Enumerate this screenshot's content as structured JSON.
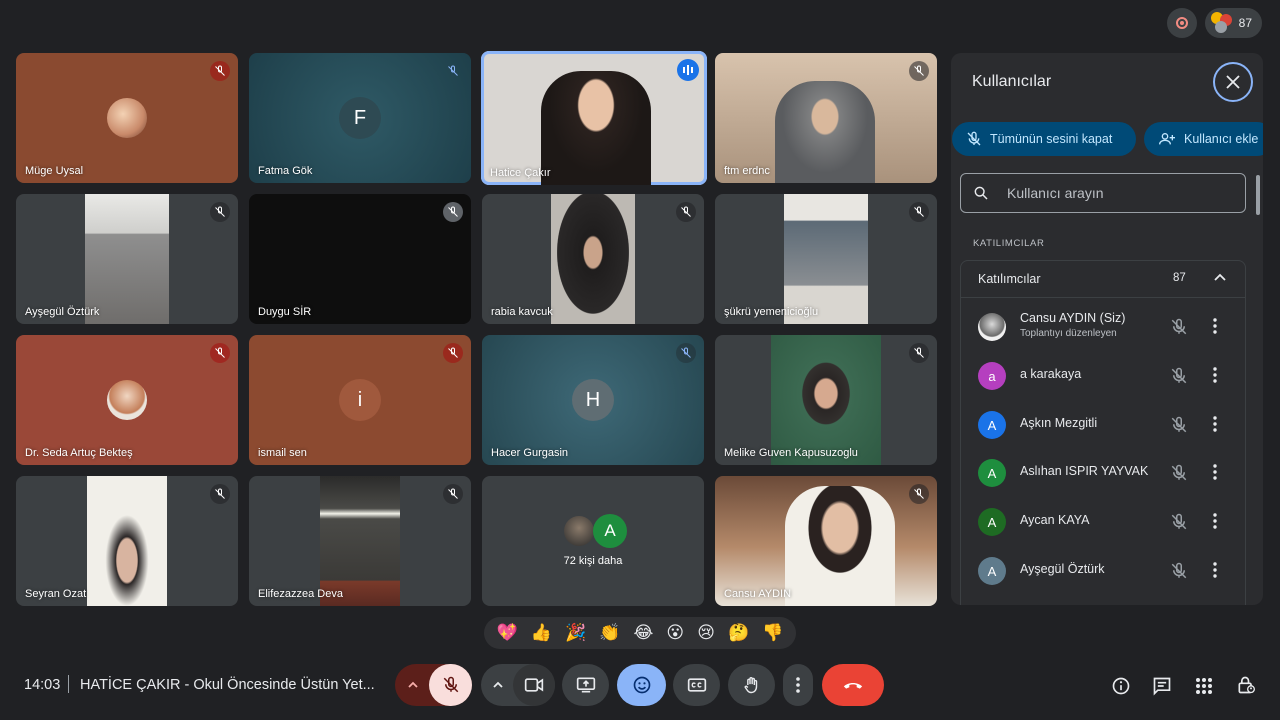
{
  "top": {
    "participant_count": "87"
  },
  "tiles": [
    {
      "name": "Müge Uysal"
    },
    {
      "name": "Fatma Gök",
      "letter": "F"
    },
    {
      "name": "Hatice Çakır"
    },
    {
      "name": "ftm erdnc"
    },
    {
      "name": "Ayşegül Öztürk"
    },
    {
      "name": "Duygu SİR"
    },
    {
      "name": "rabia kavcuk"
    },
    {
      "name": "şükrü yemenicioğlu"
    },
    {
      "name": "Dr. Seda Artuç Bekteş"
    },
    {
      "name": "ismail sen",
      "letter": "i"
    },
    {
      "name": "Hacer Gurgasin",
      "letter": "H"
    },
    {
      "name": "Melike Guven Kapusuzoglu"
    },
    {
      "name": "Seyran Ozat"
    },
    {
      "name": "Elifezazzea Deva"
    },
    {
      "name": "72 kişi daha",
      "letter": "A"
    },
    {
      "name": "Cansu AYDIN"
    }
  ],
  "panel": {
    "title": "Kullanıcılar",
    "mute_all_label": "Tümünün sesini kapat",
    "add_user_label": "Kullanıcı ekle",
    "search_placeholder": "Kullanıcı arayın",
    "section_label": "KATILIMCILAR",
    "group_title": "Katılımcılar",
    "group_count": "87",
    "participants": [
      {
        "name": "Cansu AYDIN (Siz)",
        "sub": "Toplantıyı düzenleyen"
      },
      {
        "name": "a karakaya",
        "initial": "a",
        "color": "#b53fbf"
      },
      {
        "name": "Aşkın Mezgitli",
        "initial": "A",
        "color": "#1a73e8"
      },
      {
        "name": "Aslıhan ISPIR YAYVAK",
        "initial": "A",
        "color": "#1e8e3e"
      },
      {
        "name": "Aycan KAYA",
        "initial": "A",
        "color": "#1e6b23"
      },
      {
        "name": "Ayşegül Öztürk",
        "initial": "A",
        "color": "#5f7b8c"
      }
    ]
  },
  "reactions": [
    "💖",
    "👍",
    "🎉",
    "👏",
    "😂",
    "😮",
    "😢",
    "🤔",
    "👎"
  ],
  "bottom": {
    "time": "14:03",
    "meeting_title": "HATİCE ÇAKIR - Okul Öncesinde Üstün Yet..."
  },
  "colors": {
    "accent": "#8ab4f8",
    "end_call": "#ea4335",
    "panel_button": "#004a77"
  }
}
